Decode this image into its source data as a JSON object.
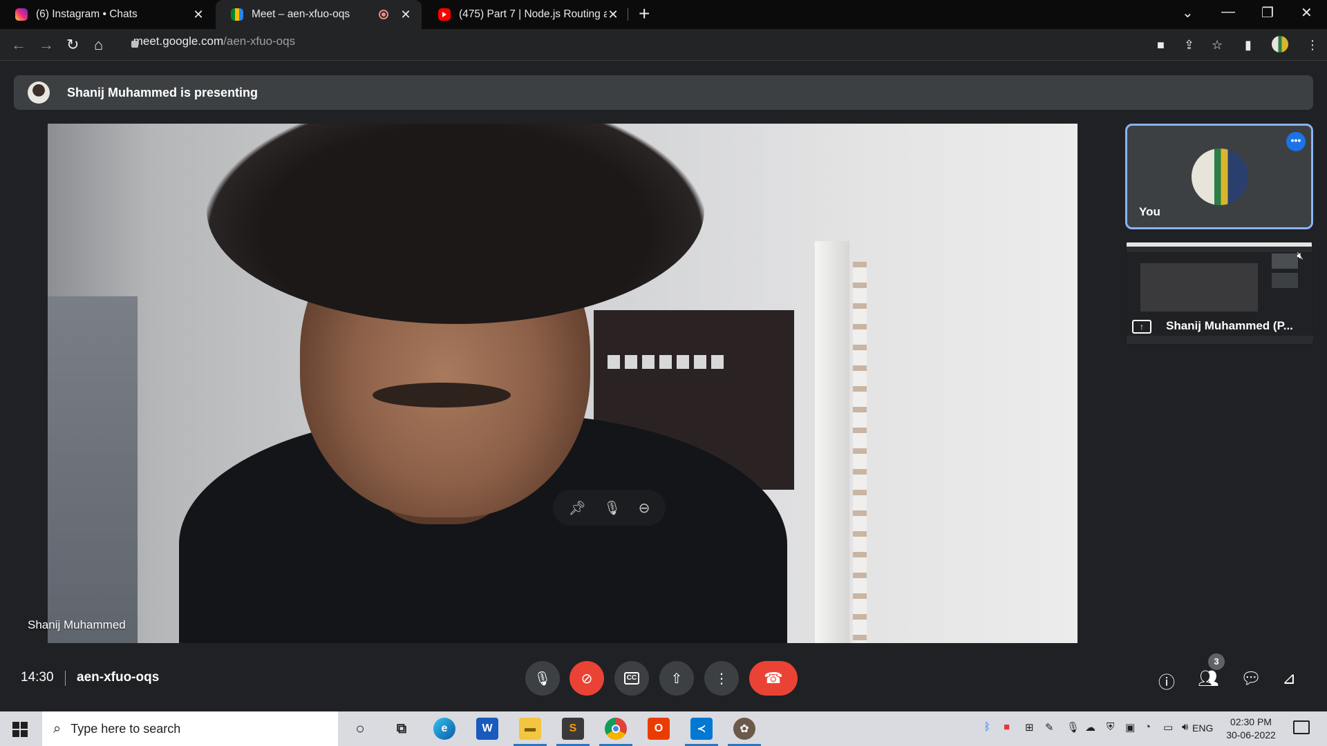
{
  "browser": {
    "tabs": [
      {
        "title": "(6) Instagram • Chats",
        "favicon": "instagram-icon",
        "active": false
      },
      {
        "title": "Meet – aen-xfuo-oqs",
        "favicon": "google-meet-icon",
        "active": true
      },
      {
        "title": "(475) Part 7 | Node.js Routing and",
        "favicon": "youtube-icon",
        "active": false
      }
    ],
    "url_host": "meet.google.com",
    "url_path": "/aen-xfuo-oqs"
  },
  "meet": {
    "presenting_banner": "Shanij Muhammed is presenting",
    "main_video_label": "Shanij Muhammed",
    "tiles": {
      "you_label": "You",
      "share_label": "Shanij Muhammed (P..."
    },
    "bottom_bar": {
      "time": "14:30",
      "meeting_code": "aen-xfuo-oqs",
      "participant_count": "3"
    },
    "colors": {
      "end_call": "#ea4335",
      "accent": "#8ab4f8"
    }
  },
  "taskbar": {
    "search_placeholder": "Type here to search",
    "language": "ENG",
    "time": "02:30 PM",
    "date": "30-06-2022"
  }
}
